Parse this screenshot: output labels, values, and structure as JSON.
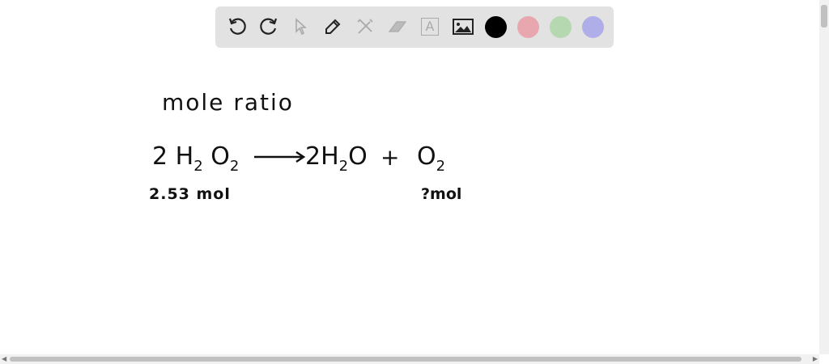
{
  "toolbar": {
    "tools": [
      "undo-icon",
      "redo-icon",
      "select-icon",
      "pen-icon",
      "tools-icon",
      "eraser-icon",
      "text-icon",
      "image-icon"
    ],
    "colors": [
      "#000000",
      "#e8a6ae",
      "#b5d8b0",
      "#b0aee8"
    ],
    "text_tool_glyph": "A"
  },
  "canvas": {
    "heading": "mole ratio",
    "reactant_coef": "2",
    "reactant": "H",
    "reactant_sub1": "2",
    "reactant_o": "O",
    "reactant_sub2": "2",
    "product1": "2H",
    "product1_sub": "2",
    "product1_o": "O",
    "plus": "+",
    "product2": "O",
    "product2_sub": "2",
    "reactant_amount": "2.53 mol",
    "product_amount": "?mol"
  }
}
